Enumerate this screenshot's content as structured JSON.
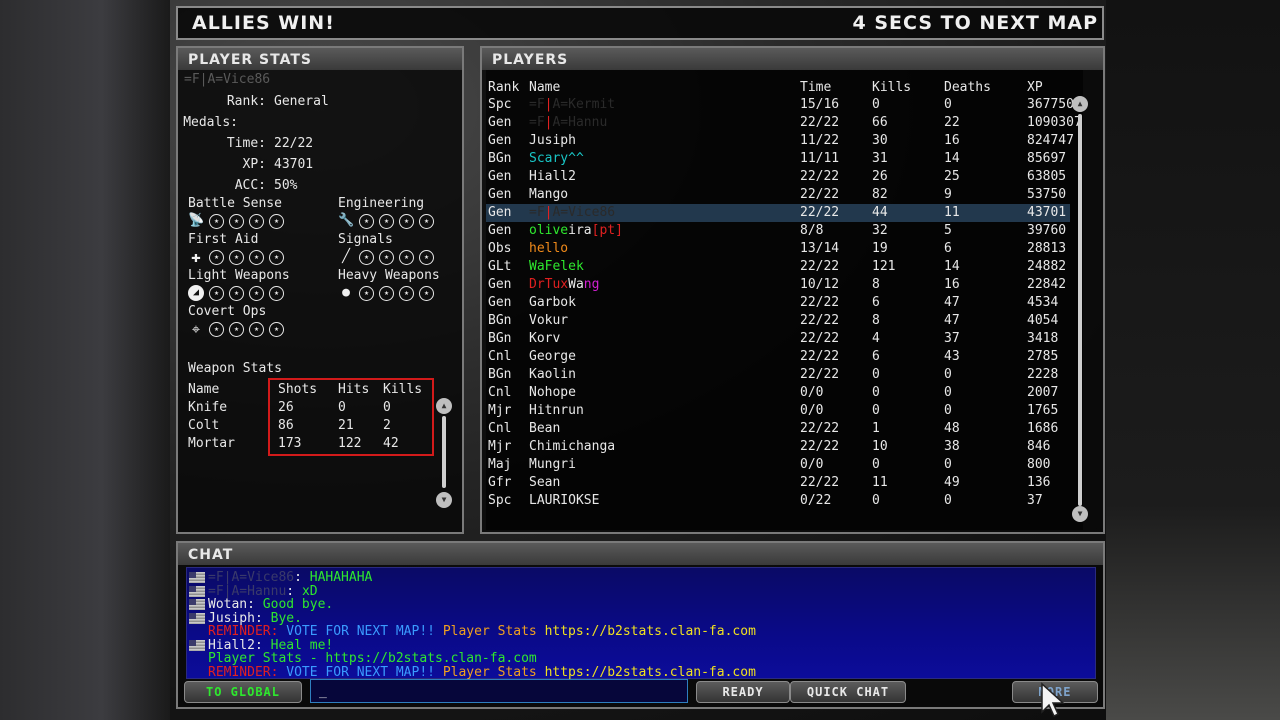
{
  "topbar": {
    "result": "ALLIES WIN!",
    "next_map": "4 SECS TO NEXT MAP"
  },
  "player_stats": {
    "title": "PLAYER STATS",
    "name": "=F|A=Vice86",
    "rank_label": "Rank:",
    "rank": "General",
    "medals_label": "Medals:",
    "medals": "",
    "time_label": "Time:",
    "time": "22/22",
    "xp_label": "XP:",
    "xp": "43701",
    "acc_label": "ACC:",
    "acc": "50%",
    "skills": [
      {
        "name": "Battle Sense",
        "icon": "radio-icon"
      },
      {
        "name": "Engineering",
        "icon": "wrench-icon"
      },
      {
        "name": "First Aid",
        "icon": "cross-icon"
      },
      {
        "name": "Signals",
        "icon": "signal-icon"
      },
      {
        "name": "Light Weapons",
        "icon": "pistol-icon"
      },
      {
        "name": "Heavy Weapons",
        "icon": "helmet-icon"
      },
      {
        "name": "Covert Ops",
        "icon": "crosshair-icon"
      }
    ],
    "weapon_stats_title": "Weapon Stats",
    "weapon_headers": [
      "Name",
      "Shots",
      "Hits",
      "Kills"
    ],
    "weapons": [
      {
        "name": "Knife",
        "shots": "26",
        "hits": "0",
        "kills": "0"
      },
      {
        "name": "Colt",
        "shots": "86",
        "hits": "21",
        "kills": "2"
      },
      {
        "name": "Mortar",
        "shots": "173",
        "hits": "122",
        "kills": "42"
      }
    ]
  },
  "players": {
    "title": "PLAYERS",
    "headers": {
      "rank": "Rank",
      "name": "Name",
      "time": "Time",
      "kills": "Kills",
      "deaths": "Deaths",
      "xp": "XP"
    },
    "rows": [
      {
        "rank": "Spc",
        "name": "=F|A=Kermit",
        "time": "15/16",
        "kills": "0",
        "deaths": "0",
        "xp": "367750"
      },
      {
        "rank": "Gen",
        "name": "=F|A=Hannu",
        "time": "22/22",
        "kills": "66",
        "deaths": "22",
        "xp": "1090307"
      },
      {
        "rank": "Gen",
        "name": "Jusiph",
        "time": "11/22",
        "kills": "30",
        "deaths": "16",
        "xp": "824747"
      },
      {
        "rank": "BGn",
        "name": "Scary^^",
        "time": "11/11",
        "kills": "31",
        "deaths": "14",
        "xp": "85697"
      },
      {
        "rank": "Gen",
        "name": "Hiall2",
        "time": "22/22",
        "kills": "26",
        "deaths": "25",
        "xp": "63805"
      },
      {
        "rank": "Gen",
        "name": "Mango",
        "time": "22/22",
        "kills": "82",
        "deaths": "9",
        "xp": "53750"
      },
      {
        "rank": "Gen",
        "name": "=F|A=Vice86",
        "time": "22/22",
        "kills": "44",
        "deaths": "11",
        "xp": "43701"
      },
      {
        "rank": "Gen",
        "name": "oliveira[pt]",
        "time": "8/8",
        "kills": "32",
        "deaths": "5",
        "xp": "39760"
      },
      {
        "rank": "Obs",
        "name": "hello",
        "time": "13/14",
        "kills": "19",
        "deaths": "6",
        "xp": "28813"
      },
      {
        "rank": "GLt",
        "name": "WaFelek",
        "time": "22/22",
        "kills": "121",
        "deaths": "14",
        "xp": "24882"
      },
      {
        "rank": "Gen",
        "name": "DrTuxWang",
        "time": "10/12",
        "kills": "8",
        "deaths": "16",
        "xp": "22842"
      },
      {
        "rank": "Gen",
        "name": "Garbok",
        "time": "22/22",
        "kills": "6",
        "deaths": "47",
        "xp": "4534"
      },
      {
        "rank": "BGn",
        "name": "Vokur",
        "time": "22/22",
        "kills": "8",
        "deaths": "47",
        "xp": "4054"
      },
      {
        "rank": "BGn",
        "name": "Korv",
        "time": "22/22",
        "kills": "4",
        "deaths": "37",
        "xp": "3418"
      },
      {
        "rank": "Cnl",
        "name": "George",
        "time": "22/22",
        "kills": "6",
        "deaths": "43",
        "xp": "2785"
      },
      {
        "rank": "BGn",
        "name": "Kaolin",
        "time": "22/22",
        "kills": "0",
        "deaths": "0",
        "xp": "2228"
      },
      {
        "rank": "Cnl",
        "name": "Nohope",
        "time": "0/0",
        "kills": "0",
        "deaths": "0",
        "xp": "2007"
      },
      {
        "rank": "Mjr",
        "name": "Hitnrun",
        "time": "0/0",
        "kills": "0",
        "deaths": "0",
        "xp": "1765"
      },
      {
        "rank": "Cnl",
        "name": "Bean",
        "time": "22/22",
        "kills": "1",
        "deaths": "48",
        "xp": "1686"
      },
      {
        "rank": "Mjr",
        "name": "Chimichanga",
        "time": "22/22",
        "kills": "10",
        "deaths": "38",
        "xp": "846"
      },
      {
        "rank": "Maj",
        "name": "Mungri",
        "time": "0/0",
        "kills": "0",
        "deaths": "0",
        "xp": "800"
      },
      {
        "rank": "Gfr",
        "name": "Sean",
        "time": "22/22",
        "kills": "11",
        "deaths": "49",
        "xp": "136"
      },
      {
        "rank": "Spc",
        "name": "LAURIOKSE",
        "time": "0/22",
        "kills": "0",
        "deaths": "0",
        "xp": "37"
      }
    ]
  },
  "chat": {
    "title": "CHAT",
    "lines": [
      {
        "sender": "=F|A=Vice86",
        "sep": ": ",
        "message": "HAHAHAHA",
        "flag": true
      },
      {
        "sender": "=F|A=Hannu",
        "sep": ": ",
        "message": "xD",
        "flag": true
      },
      {
        "sender": "Wotan",
        "sep": ": ",
        "message": "Good bye.",
        "flag": true
      },
      {
        "sender": "Jusiph",
        "sep": ": ",
        "message": "Bye.",
        "flag": true
      },
      {
        "sender": "REMINDER:",
        "sep": " ",
        "message": "VOTE FOR NEXT MAP!!",
        "extra1": " Player Stats",
        "extra2": " https://b2stats.clan-fa.com",
        "flag": false
      },
      {
        "sender": "Hiall2",
        "sep": ": ",
        "message": "Heal me!",
        "flag": true
      },
      {
        "sender": "Player Stats - https://b2stats.clan-fa.com",
        "sep": "",
        "message": "",
        "flag": false
      },
      {
        "sender": "REMINDER:",
        "sep": " ",
        "message": "VOTE FOR NEXT MAP!!",
        "extra1": " Player Stats",
        "extra2": " https://b2stats.clan-fa.com",
        "flag": false
      }
    ],
    "buttons": {
      "global": "TO GLOBAL",
      "ready": "READY",
      "quick_chat": "QUICK CHAT",
      "more": "MORE"
    },
    "input_value": "_"
  },
  "colors": {
    "clan_green": "#1fae1f",
    "clan_red": "#e02020",
    "name_cyan": "#19c6c6",
    "name_green": "#2ee82e",
    "name_orange": "#f08a1a",
    "reminder_red": "#e02020",
    "reminder_blue": "#3a9bff",
    "stats_orange": "#f0a020",
    "url_yellow": "#f0e020",
    "chat_green": "#2ee82e",
    "highlight": "#22384d"
  }
}
